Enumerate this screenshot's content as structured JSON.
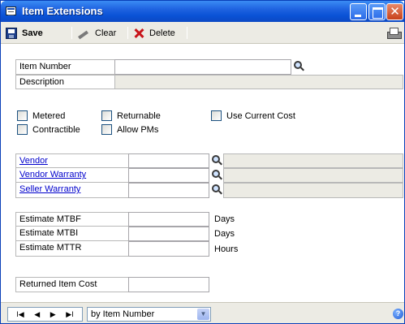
{
  "window": {
    "title": "Item Extensions"
  },
  "toolbar": {
    "save_label": "Save",
    "clear_label": "Clear",
    "delete_label": "Delete"
  },
  "form": {
    "item_number_label": "Item Number",
    "item_number_value": "",
    "description_label": "Description",
    "description_value": "",
    "checkboxes": {
      "metered": {
        "label": "Metered",
        "checked": false
      },
      "returnable": {
        "label": "Returnable",
        "checked": false
      },
      "use_current_cost": {
        "label": "Use Current Cost",
        "checked": false
      },
      "contractible": {
        "label": "Contractible",
        "checked": false
      },
      "allow_pms": {
        "label": "Allow PMs",
        "checked": false
      }
    },
    "vendor_label": "Vendor",
    "vendor_warranty_label": "Vendor Warranty",
    "seller_warranty_label": "Seller Warranty",
    "mtbf_label": "Estimate MTBF",
    "mtbi_label": "Estimate MTBI",
    "mttr_label": "Estimate MTTR",
    "mtbf_unit": "Days",
    "mtbi_unit": "Days",
    "mttr_unit": "Hours",
    "returned_item_cost_label": "Returned Item Cost"
  },
  "footer": {
    "nav_first": "I◀",
    "nav_prev": "◀",
    "nav_next": "▶",
    "nav_last": "▶I",
    "sort_value": "by Item Number"
  }
}
